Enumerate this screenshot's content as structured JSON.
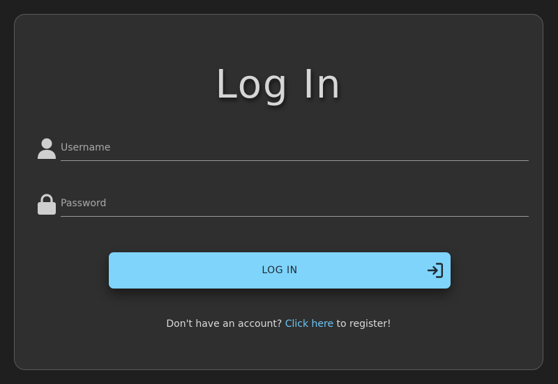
{
  "page": {
    "title": "Log In"
  },
  "form": {
    "username": {
      "placeholder": "Username",
      "value": "",
      "icon": "user-icon"
    },
    "password": {
      "placeholder": "Password",
      "value": "",
      "icon": "lock-icon"
    },
    "submit_label": "LOG IN",
    "submit_icon": "login-arrow-icon"
  },
  "footer": {
    "prefix": "Don't have an account?",
    "link_text": "Click here",
    "suffix": "to register!"
  },
  "colors": {
    "background": "#1f1f1f",
    "card": "#2f2f2f",
    "button": "#7fd4fb",
    "link": "#6cc4f2",
    "title": "#d6d6d6"
  }
}
